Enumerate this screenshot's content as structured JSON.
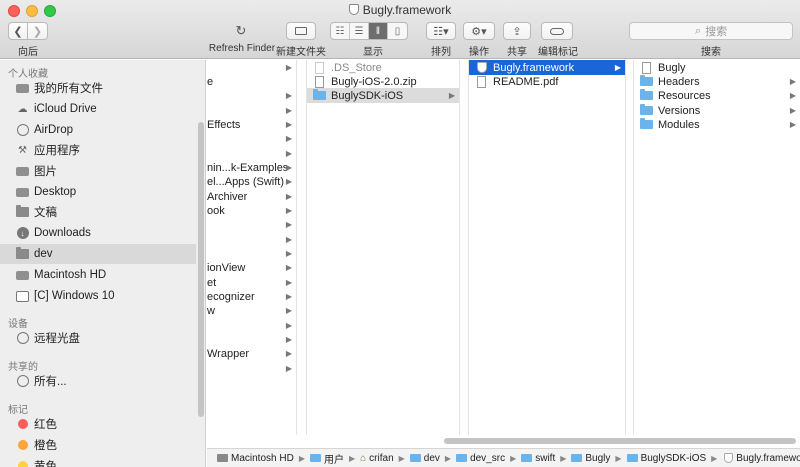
{
  "window": {
    "title": "Bugly.framework"
  },
  "toolbar": {
    "back_label": "向后",
    "refresh_label": "Refresh Finder",
    "new_folder_label": "新建文件夹",
    "view_label": "显示",
    "arrange_label": "排列",
    "action_label": "操作",
    "share_label": "共享",
    "tags_label": "编辑标记",
    "search_placeholder": "搜索",
    "search_label": "搜索"
  },
  "sidebar": {
    "favorites_header": "个人收藏",
    "favorites": [
      {
        "label": "我的所有文件",
        "icon": "all-files-icon"
      },
      {
        "label": "iCloud Drive",
        "icon": "cloud-icon"
      },
      {
        "label": "AirDrop",
        "icon": "airdrop-icon"
      },
      {
        "label": "应用程序",
        "icon": "applications-icon"
      },
      {
        "label": "图片",
        "icon": "camera-icon"
      },
      {
        "label": "Desktop",
        "icon": "desktop-folder-icon"
      },
      {
        "label": "文稿",
        "icon": "document-folder-icon"
      },
      {
        "label": "Downloads",
        "icon": "downloads-icon"
      },
      {
        "label": "dev",
        "icon": "folder-icon"
      },
      {
        "label": "Macintosh HD",
        "icon": "disk-icon"
      },
      {
        "label": "[C] Windows 10",
        "icon": "display-icon"
      }
    ],
    "devices_header": "设备",
    "devices": [
      {
        "label": "远程光盘",
        "icon": "disc-icon"
      }
    ],
    "shared_header": "共享的",
    "shared": [
      {
        "label": "所有...",
        "icon": "network-icon"
      }
    ],
    "tags_header": "标记",
    "tags": [
      {
        "label": "红色",
        "color": "#fc5c58"
      },
      {
        "label": "橙色",
        "color": "#fda43a"
      },
      {
        "label": "黄色",
        "color": "#fdd33b"
      }
    ]
  },
  "column1": {
    "rows": [
      {
        "label": "",
        "arrow": true
      },
      {
        "label": "e",
        "arrow": false
      },
      {
        "label": "",
        "arrow": true
      },
      {
        "label": "",
        "arrow": true
      },
      {
        "label": "Effects",
        "arrow": true
      },
      {
        "label": "",
        "arrow": true
      },
      {
        "label": "",
        "arrow": true
      },
      {
        "label": "nin...k-Examples",
        "arrow": true
      },
      {
        "label": "el...Apps (Swift)",
        "arrow": true
      },
      {
        "label": "Archiver",
        "arrow": true
      },
      {
        "label": "ook",
        "arrow": true
      },
      {
        "label": "",
        "arrow": true
      },
      {
        "label": "",
        "arrow": true
      },
      {
        "label": "",
        "arrow": true
      },
      {
        "label": "ionView",
        "arrow": true
      },
      {
        "label": "et",
        "arrow": true
      },
      {
        "label": "ecognizer",
        "arrow": true
      },
      {
        "label": "w",
        "arrow": true
      },
      {
        "label": "",
        "arrow": true
      },
      {
        "label": "",
        "arrow": true
      },
      {
        "label": "Wrapper",
        "arrow": true
      },
      {
        "label": "",
        "arrow": true
      }
    ]
  },
  "column2": {
    "rows": [
      {
        "label": ".DS_Store",
        "kind": "file-dim"
      },
      {
        "label": "Bugly-iOS-2.0.zip",
        "kind": "file"
      },
      {
        "label": "BuglySDK-iOS",
        "kind": "folder",
        "arrow": true
      }
    ]
  },
  "column3": {
    "rows": [
      {
        "label": "Bugly.framework",
        "kind": "framework",
        "arrow": true
      },
      {
        "label": "README.pdf",
        "kind": "pdf"
      }
    ]
  },
  "column4": {
    "rows": [
      {
        "label": "Bugly",
        "kind": "file"
      },
      {
        "label": "Headers",
        "kind": "folder",
        "arrow": true
      },
      {
        "label": "Resources",
        "kind": "folder",
        "arrow": true
      },
      {
        "label": "Versions",
        "kind": "folder",
        "arrow": true
      },
      {
        "label": "Modules",
        "kind": "folder",
        "arrow": true
      }
    ]
  },
  "pathbar": {
    "items": [
      {
        "label": "Macintosh HD",
        "icon": "disk-icon"
      },
      {
        "label": "用户",
        "icon": "folder-icon"
      },
      {
        "label": "crifan",
        "icon": "home-icon"
      },
      {
        "label": "dev",
        "icon": "folder-icon"
      },
      {
        "label": "dev_src",
        "icon": "folder-icon"
      },
      {
        "label": "swift",
        "icon": "folder-icon"
      },
      {
        "label": "Bugly",
        "icon": "folder-icon"
      },
      {
        "label": "BuglySDK-iOS",
        "icon": "folder-icon"
      },
      {
        "label": "Bugly.framework",
        "icon": "framework-icon"
      }
    ]
  }
}
